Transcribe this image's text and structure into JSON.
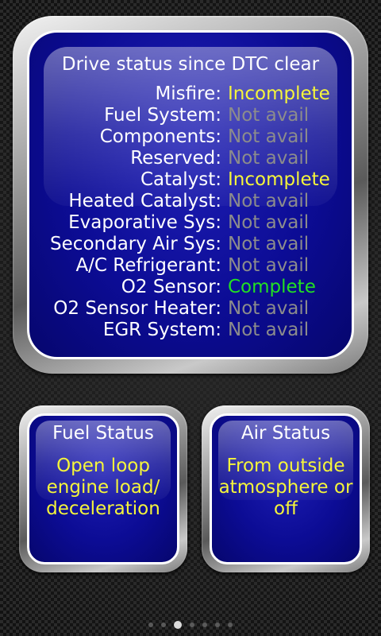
{
  "drive_status": {
    "title": "Drive status since DTC clear",
    "rows": [
      {
        "label": "Misfire:",
        "value": "Incomplete"
      },
      {
        "label": "Fuel System:",
        "value": "Not avail"
      },
      {
        "label": "Components:",
        "value": "Not avail"
      },
      {
        "label": "Reserved:",
        "value": "Not avail"
      },
      {
        "label": "Catalyst:",
        "value": "Incomplete"
      },
      {
        "label": "Heated Catalyst:",
        "value": "Not avail"
      },
      {
        "label": "Evaporative Sys:",
        "value": "Not avail"
      },
      {
        "label": "Secondary Air Sys:",
        "value": "Not avail"
      },
      {
        "label": "A/C Refrigerant:",
        "value": "Not avail"
      },
      {
        "label": "O2 Sensor:",
        "value": "Complete"
      },
      {
        "label": "O2 Sensor Heater:",
        "value": "Not avail"
      },
      {
        "label": "EGR System:",
        "value": "Not avail"
      }
    ]
  },
  "fuel_status": {
    "title": "Fuel Status",
    "value": "Open loop\nengine load/\ndeceleration"
  },
  "air_status": {
    "title": "Air Status",
    "value": "From outside\natmosphere or\noff"
  },
  "pager": {
    "page_count": 7,
    "active_page": 3
  },
  "colors": {
    "incomplete": "#f5f53a",
    "not_avail": "#8c8c8c",
    "complete": "#22e022",
    "panel_blue": "#0c0c95"
  }
}
